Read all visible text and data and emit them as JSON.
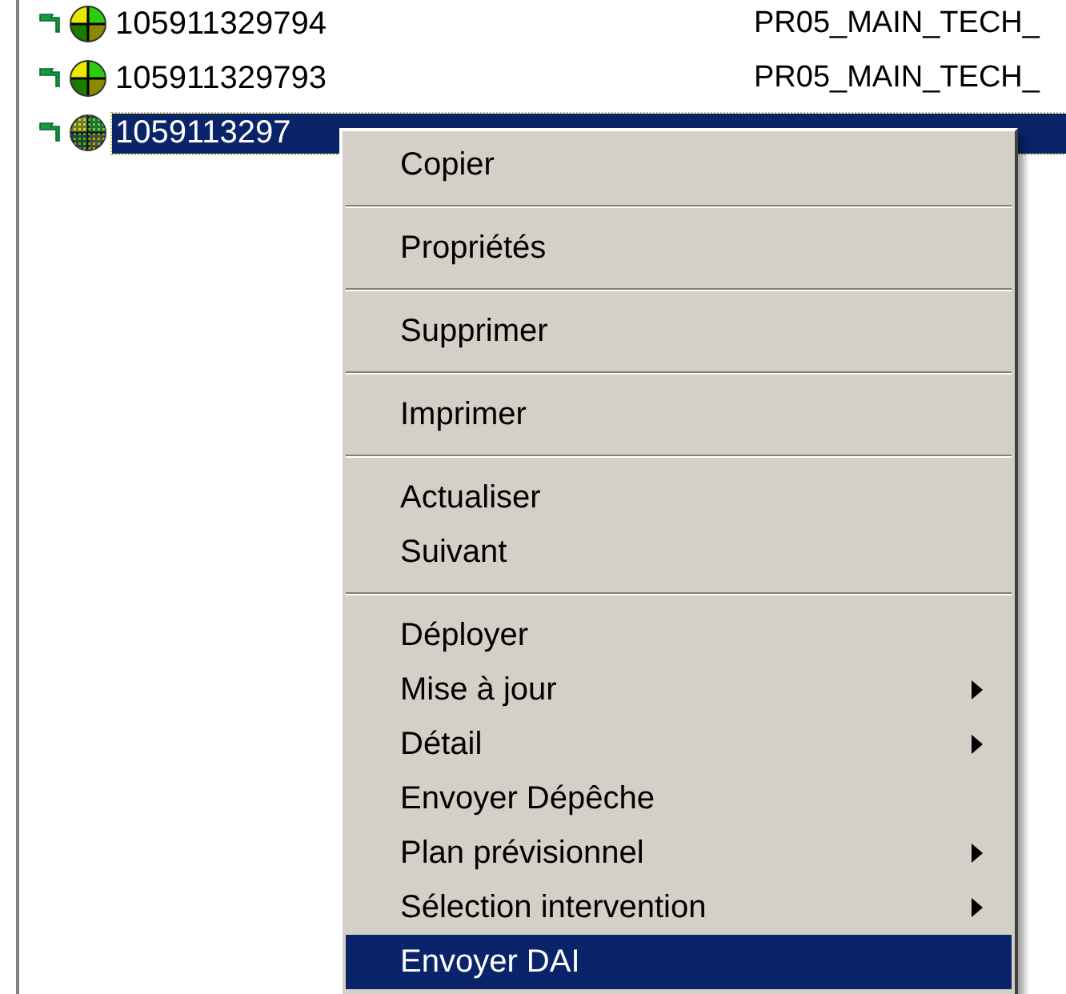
{
  "tree": {
    "rows": [
      {
        "id": "105911329794",
        "column_2": "PR05_MAIN_TECH_",
        "selected": false
      },
      {
        "id": "105911329793",
        "column_2": "PR05_MAIN_TECH_",
        "selected": false
      },
      {
        "id": "1059113297",
        "selected": true
      }
    ]
  },
  "context_menu": {
    "groups": [
      [
        {
          "label": "Copier",
          "submenu": false,
          "selected": false
        }
      ],
      [
        {
          "label": "Propriétés",
          "submenu": false,
          "selected": false
        }
      ],
      [
        {
          "label": "Supprimer",
          "submenu": false,
          "selected": false
        }
      ],
      [
        {
          "label": "Imprimer",
          "submenu": false,
          "selected": false
        }
      ],
      [
        {
          "label": "Actualiser",
          "submenu": false,
          "selected": false
        },
        {
          "label": "Suivant",
          "submenu": false,
          "selected": false
        }
      ],
      [
        {
          "label": "Déployer",
          "submenu": false,
          "selected": false
        },
        {
          "label": "Mise à jour",
          "submenu": true,
          "selected": false
        },
        {
          "label": "Détail",
          "submenu": true,
          "selected": false
        },
        {
          "label": "Envoyer Dépêche",
          "submenu": false,
          "selected": false
        },
        {
          "label": "Plan prévisionnel",
          "submenu": true,
          "selected": false
        },
        {
          "label": "Sélection intervention",
          "submenu": true,
          "selected": false
        },
        {
          "label": "Envoyer DAI",
          "submenu": false,
          "selected": true
        }
      ]
    ]
  }
}
